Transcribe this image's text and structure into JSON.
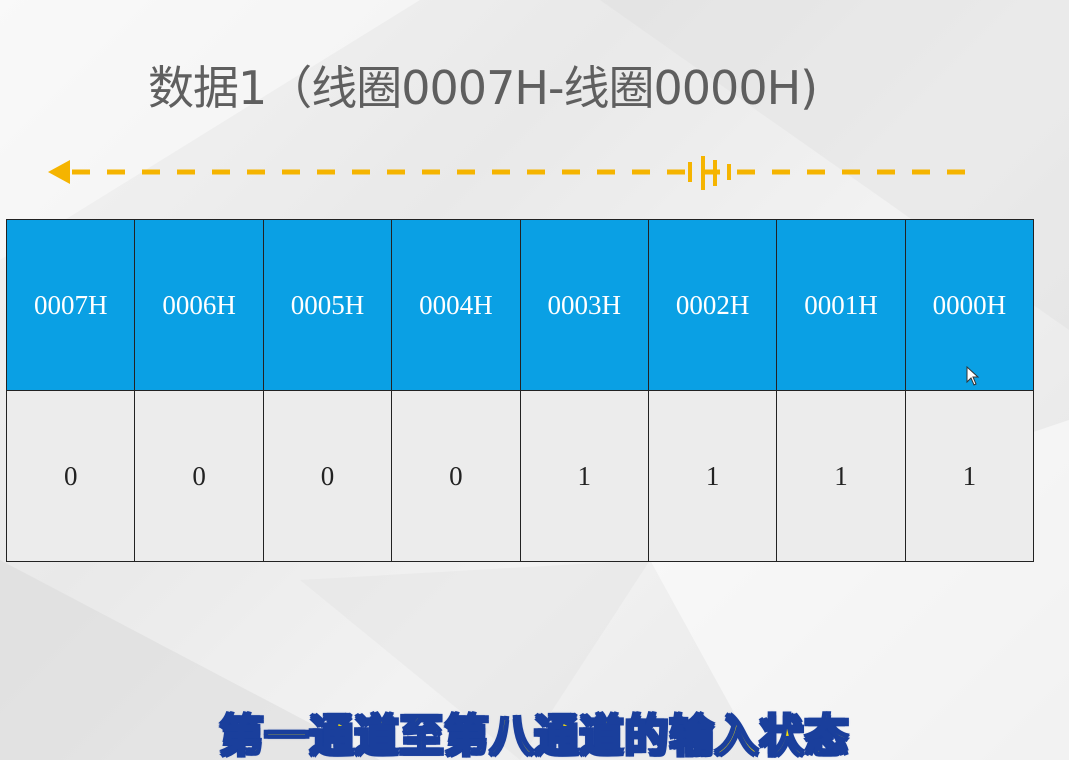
{
  "slide": {
    "title": "数据1（线圈0007H-线圈0000H)",
    "subtitle": "第一通道至第八通道的输入状态",
    "colors": {
      "header_bg": "#0aa0e4",
      "value_bg": "#ececec",
      "arrow": "#f5b400",
      "subtitle_fill": "#ffe400",
      "subtitle_stroke": "#1a3f9c"
    }
  },
  "table": {
    "headers": [
      "0007H",
      "0006H",
      "0005H",
      "0004H",
      "0003H",
      "0002H",
      "0001H",
      "0000H"
    ],
    "values": [
      "0",
      "0",
      "0",
      "0",
      "1",
      "1",
      "1",
      "1"
    ]
  },
  "icons": {
    "direction_arrow": "left-arrow-dashed-icon",
    "cursor": "mouse-pointer-icon"
  }
}
